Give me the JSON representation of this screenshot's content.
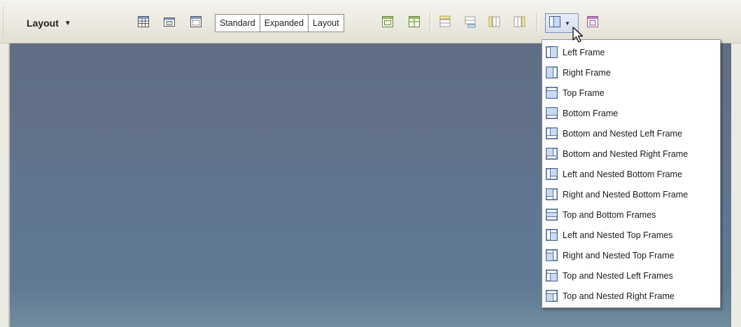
{
  "toolbar": {
    "layout_menu_label": "Layout",
    "layout_menu_arrow": "▼",
    "view_modes": [
      "Standard",
      "Expanded",
      "Layout"
    ],
    "frames_button_arrow": "▼"
  },
  "frames_menu": {
    "items": [
      {
        "label": "Left Frame",
        "icon": "left-frame-icon"
      },
      {
        "label": "Right Frame",
        "icon": "right-frame-icon"
      },
      {
        "label": "Top Frame",
        "icon": "top-frame-icon"
      },
      {
        "label": "Bottom Frame",
        "icon": "bottom-frame-icon"
      },
      {
        "label": "Bottom and Nested Left Frame",
        "icon": "bottom-nested-left-frame-icon"
      },
      {
        "label": "Bottom and Nested Right Frame",
        "icon": "bottom-nested-right-frame-icon"
      },
      {
        "label": "Left and Nested Bottom Frame",
        "icon": "left-nested-bottom-frame-icon"
      },
      {
        "label": "Right and Nested Bottom Frame",
        "icon": "right-nested-bottom-frame-icon"
      },
      {
        "label": "Top and Bottom Frames",
        "icon": "top-bottom-frames-icon"
      },
      {
        "label": "Left and Nested Top Frames",
        "icon": "left-nested-top-frames-icon"
      },
      {
        "label": "Right and Nested Top Frame",
        "icon": "right-nested-top-frame-icon"
      },
      {
        "label": "Top and Nested Left Frames",
        "icon": "top-nested-left-frames-icon"
      },
      {
        "label": "Top and Nested Right Frame",
        "icon": "top-nested-right-frame-icon"
      }
    ]
  },
  "colors": {
    "toolbar_bg": "#ebe9df",
    "canvas_top": "#5f6e85",
    "canvas_bottom": "#708c9f",
    "frame_icon_fill": "#c9dbf3",
    "frame_icon_stroke": "#3d5d8f"
  }
}
